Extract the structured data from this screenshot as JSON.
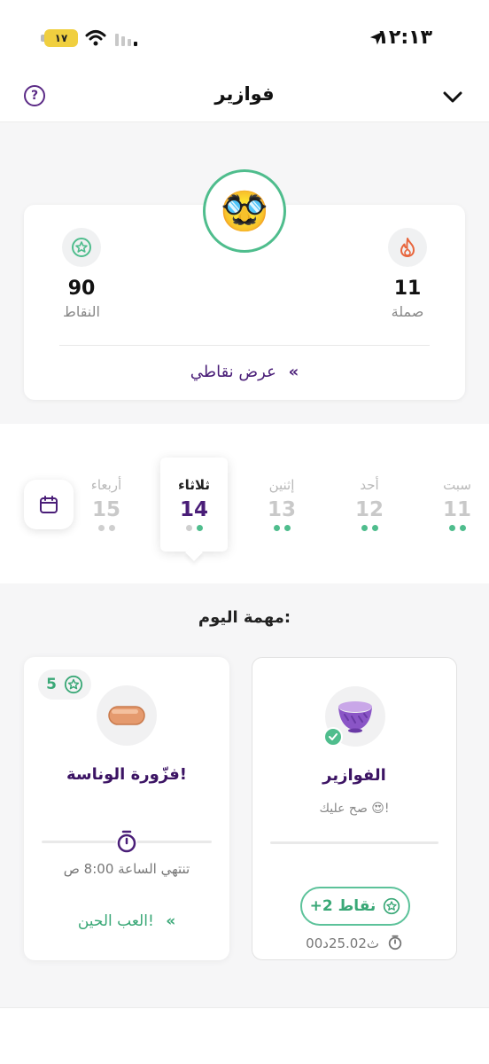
{
  "status_bar": {
    "time": "١٢:١٣",
    "battery": "١٧"
  },
  "header": {
    "title": "فوازير",
    "help_label": "?"
  },
  "score_card": {
    "avatar_emoji": "🥸",
    "streak": {
      "value": "11",
      "label": "صملة",
      "icon": "fire-icon"
    },
    "points": {
      "value": "90",
      "label": "النقاط",
      "icon": "star-icon"
    },
    "view_points_label": "عرض نقاطي",
    "view_points_chevron": "«"
  },
  "days": [
    {
      "name": "سبت",
      "num": "11",
      "dots": [
        "green",
        "green"
      ]
    },
    {
      "name": "أحد",
      "num": "12",
      "dots": [
        "green",
        "green"
      ]
    },
    {
      "name": "إثنين",
      "num": "13",
      "dots": [
        "green",
        "green"
      ]
    },
    {
      "name": "ثلاثاء",
      "num": "14",
      "dots": [
        "green",
        "grey"
      ],
      "active": true
    },
    {
      "name": "أربعاء",
      "num": "15",
      "dots": [
        "grey",
        "grey"
      ]
    }
  ],
  "tasks": {
    "heading": "مهمة اليوم:",
    "completed": {
      "title": "الفوازير",
      "subtitle": "صح عليك 😍!",
      "points_label": "+2 نقاط",
      "timer": "ث25.02د00",
      "icon": "bowl-icon"
    },
    "pending": {
      "title": "فزّورة الوناسة!",
      "badge_value": "5",
      "ends_label": "تنتهي  الساعة 8:00 ص",
      "play_label": "العب الحين!",
      "icon": "sausage-icon"
    }
  }
}
